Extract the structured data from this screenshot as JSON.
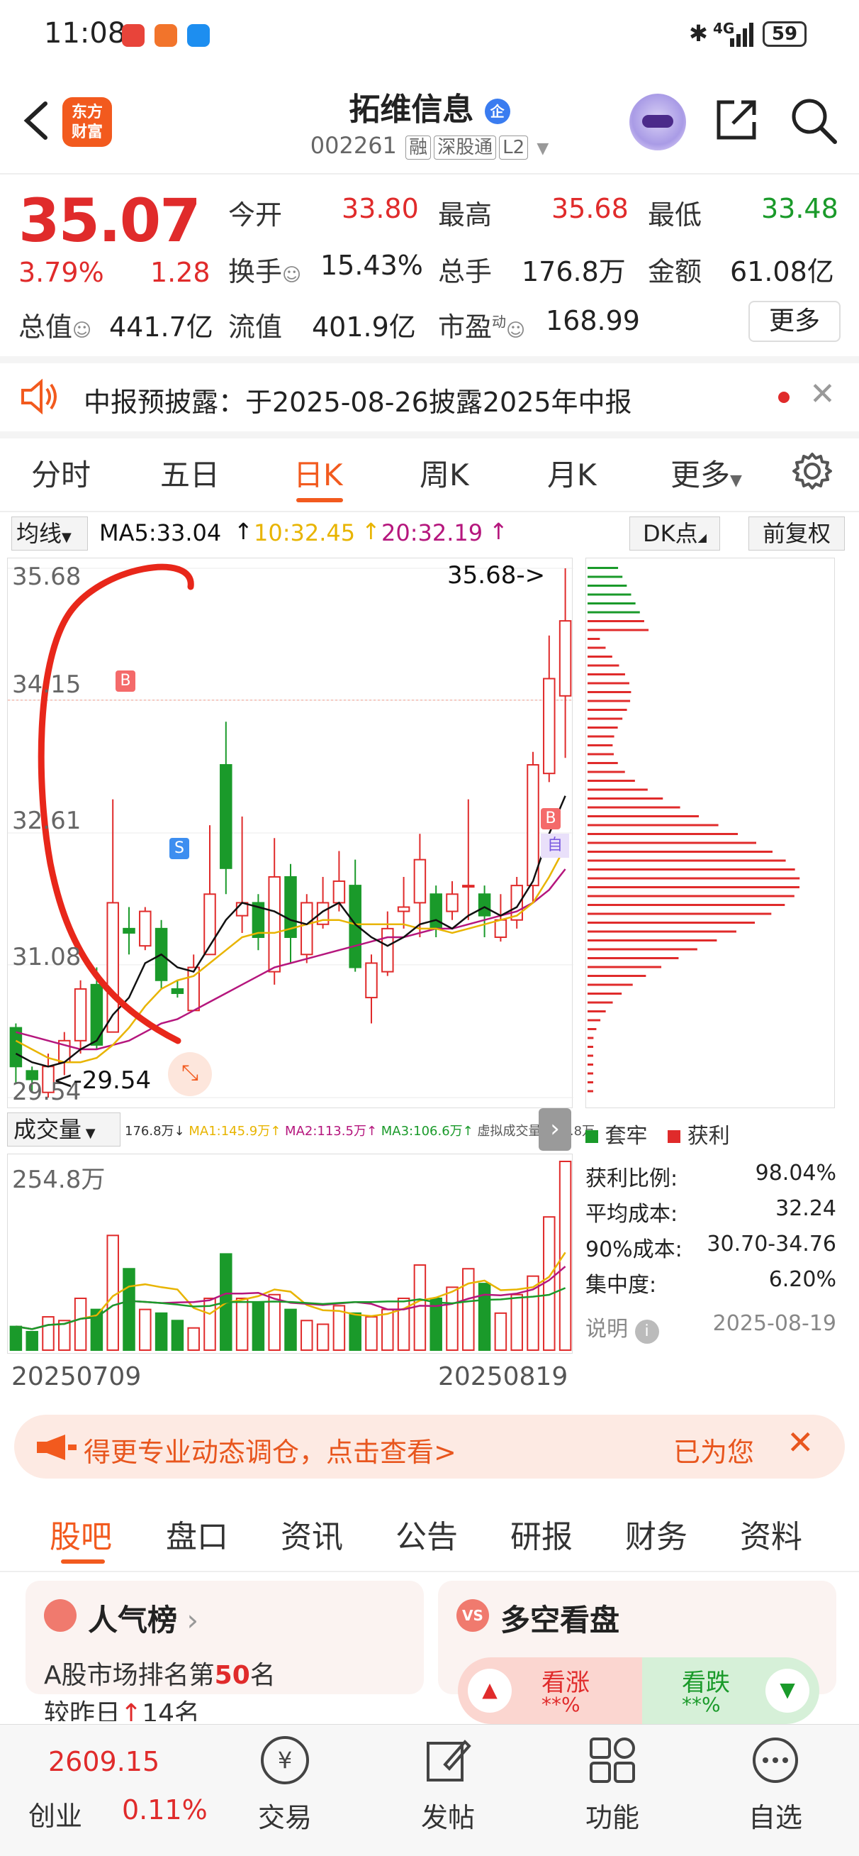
{
  "status_bar": {
    "time": "11:08",
    "network": "4G",
    "battery": "59"
  },
  "header": {
    "logo_line1": "东方",
    "logo_line2": "财富",
    "title": "拓维信息",
    "title_badge": "企",
    "code": "002261",
    "tags": [
      "融",
      "深股通",
      "L2"
    ]
  },
  "quote": {
    "price": "35.07",
    "change_pct": "3.79%",
    "change": "1.28",
    "open_label": "今开",
    "open": "33.80",
    "high_label": "最高",
    "high": "35.68",
    "low_label": "最低",
    "low": "33.48",
    "turnover_label": "换手",
    "turnover": "15.43%",
    "volume_label": "总手",
    "volume": "176.8万",
    "amount_label": "金额",
    "amount": "61.08亿",
    "mktcap_label": "总值",
    "mktcap": "441.7亿",
    "float_label": "流值",
    "float_cap": "401.9亿",
    "pe_label": "市盈",
    "pe_sup": "动",
    "pe": "168.99",
    "more_button": "更多"
  },
  "notice": {
    "text": "中报预披露：于2025-08-26披露2025年中报"
  },
  "kline_tabs": [
    "分时",
    "五日",
    "日K",
    "周K",
    "月K",
    "更多"
  ],
  "kline_active": "日K",
  "ma_bar": {
    "selector": "均线",
    "ma5": "MA5:33.04",
    "ma10": "10:32.45",
    "ma20": "20:32.19",
    "dk_button": "DK点",
    "fq_button": "前复权"
  },
  "chart_data": {
    "type": "candlestick",
    "y_ticks": [
      "35.68",
      "34.15",
      "32.61",
      "31.08",
      "29.54"
    ],
    "high_annotation": "35.68->",
    "low_annotation": "<-29.54",
    "start_date": "20250709",
    "end_date": "20250819",
    "volume_max_label": "254.8万",
    "candles": [
      {
        "o": 30.35,
        "c": 29.9,
        "h": 30.4,
        "l": 29.7
      },
      {
        "o": 29.85,
        "c": 29.75,
        "h": 29.9,
        "l": 29.6
      },
      {
        "o": 29.6,
        "c": 29.9,
        "h": 30.05,
        "l": 29.54
      },
      {
        "o": 29.95,
        "c": 30.2,
        "h": 30.3,
        "l": 29.8
      },
      {
        "o": 30.2,
        "c": 30.8,
        "h": 30.9,
        "l": 30.05
      },
      {
        "o": 30.85,
        "c": 30.15,
        "h": 31.05,
        "l": 30.1
      },
      {
        "o": 30.3,
        "c": 31.8,
        "h": 33.0,
        "l": 30.3
      },
      {
        "o": 31.5,
        "c": 31.45,
        "h": 31.75,
        "l": 31.2
      },
      {
        "o": 31.3,
        "c": 31.7,
        "h": 31.75,
        "l": 31.25
      },
      {
        "o": 31.5,
        "c": 30.9,
        "h": 31.6,
        "l": 30.8
      },
      {
        "o": 30.8,
        "c": 30.75,
        "h": 30.9,
        "l": 30.7
      },
      {
        "o": 30.55,
        "c": 31.05,
        "h": 31.2,
        "l": 30.55
      },
      {
        "o": 31.2,
        "c": 31.9,
        "h": 32.7,
        "l": 31.2
      },
      {
        "o": 33.4,
        "c": 32.2,
        "h": 33.9,
        "l": 31.9
      },
      {
        "o": 31.65,
        "c": 31.8,
        "h": 32.8,
        "l": 31.45
      },
      {
        "o": 31.8,
        "c": 31.4,
        "h": 31.9,
        "l": 31.25
      },
      {
        "o": 31.0,
        "c": 32.1,
        "h": 32.55,
        "l": 30.85
      },
      {
        "o": 32.1,
        "c": 31.4,
        "h": 32.25,
        "l": 31.1
      },
      {
        "o": 31.2,
        "c": 31.8,
        "h": 31.9,
        "l": 31.1
      },
      {
        "o": 31.55,
        "c": 31.8,
        "h": 32.1,
        "l": 31.5
      },
      {
        "o": 31.8,
        "c": 32.05,
        "h": 32.4,
        "l": 31.7
      },
      {
        "o": 32.0,
        "c": 31.05,
        "h": 32.3,
        "l": 31.0
      },
      {
        "o": 30.7,
        "c": 31.1,
        "h": 31.2,
        "l": 30.4
      },
      {
        "o": 31.0,
        "c": 31.5,
        "h": 31.7,
        "l": 30.95
      },
      {
        "o": 31.7,
        "c": 31.75,
        "h": 32.1,
        "l": 31.5
      },
      {
        "o": 31.8,
        "c": 32.3,
        "h": 32.6,
        "l": 31.4
      },
      {
        "o": 31.9,
        "c": 31.5,
        "h": 32.0,
        "l": 31.4
      },
      {
        "o": 31.7,
        "c": 31.9,
        "h": 32.05,
        "l": 31.6
      },
      {
        "o": 32.0,
        "c": 32.0,
        "h": 33.0,
        "l": 31.6
      },
      {
        "o": 31.9,
        "c": 31.65,
        "h": 32.0,
        "l": 31.4
      },
      {
        "o": 31.4,
        "c": 31.6,
        "h": 31.9,
        "l": 31.35
      },
      {
        "o": 31.6,
        "c": 32.0,
        "h": 32.1,
        "l": 31.5
      },
      {
        "o": 32.0,
        "c": 33.4,
        "h": 33.55,
        "l": 31.8
      },
      {
        "o": 33.3,
        "c": 34.4,
        "h": 34.9,
        "l": 33.2
      },
      {
        "o": 34.2,
        "c": 35.07,
        "h": 35.68,
        "l": 33.48
      }
    ],
    "ma5": [
      30.05,
      29.95,
      29.9,
      29.95,
      30.1,
      30.2,
      30.5,
      30.7,
      31.1,
      31.2,
      31.05,
      31.0,
      31.3,
      31.6,
      31.8,
      31.75,
      31.7,
      31.6,
      31.55,
      31.7,
      31.8,
      31.55,
      31.4,
      31.3,
      31.4,
      31.55,
      31.6,
      31.5,
      31.65,
      31.75,
      31.65,
      31.75,
      32.05,
      32.6,
      33.04
    ],
    "ma10": [
      30.2,
      30.1,
      30.0,
      29.95,
      29.95,
      30.0,
      30.15,
      30.35,
      30.6,
      30.8,
      30.9,
      30.95,
      31.1,
      31.25,
      31.4,
      31.45,
      31.45,
      31.5,
      31.55,
      31.6,
      31.6,
      31.55,
      31.55,
      31.55,
      31.55,
      31.5,
      31.5,
      31.45,
      31.5,
      31.55,
      31.6,
      31.65,
      31.8,
      32.1,
      32.45
    ],
    "ma20": [
      30.3,
      30.25,
      30.2,
      30.15,
      30.1,
      30.1,
      30.15,
      30.2,
      30.3,
      30.4,
      30.45,
      30.55,
      30.65,
      30.75,
      30.85,
      30.95,
      31.05,
      31.1,
      31.15,
      31.2,
      31.25,
      31.3,
      31.35,
      31.4,
      31.4,
      31.45,
      31.5,
      31.5,
      31.55,
      31.6,
      31.65,
      31.7,
      31.8,
      31.95,
      32.19
    ],
    "volumes": [
      0.32,
      0.25,
      0.45,
      0.4,
      0.7,
      0.55,
      1.55,
      1.1,
      0.55,
      0.5,
      0.4,
      0.3,
      0.7,
      1.3,
      0.7,
      0.65,
      0.75,
      0.55,
      0.4,
      0.35,
      0.6,
      0.5,
      0.45,
      0.55,
      0.7,
      1.15,
      0.7,
      0.85,
      1.1,
      0.9,
      0.5,
      0.75,
      1.0,
      1.8,
      2.55
    ],
    "volume_legend": {
      "label": "成交量",
      "vol": "176.8万",
      "ma1": "MA1:145.9万",
      "ma2": "MA2:113.5万",
      "ma3": "MA3:106.6万",
      "virtual": "虚拟成交量:254.8万"
    }
  },
  "chip_panel": {
    "legend_trap": "套牢",
    "legend_profit": "获利",
    "rows": [
      {
        "label": "获利比例:",
        "value": "98.04%"
      },
      {
        "label": "平均成本:",
        "value": "32.24"
      },
      {
        "label": "90%成本:",
        "value": "30.70-34.76"
      },
      {
        "label": "集中度:",
        "value": "6.20%"
      }
    ],
    "note_label": "说明",
    "note_date": "2025-08-19"
  },
  "banner": {
    "text": "得更专业动态调仓，点击查看>",
    "right_text": "已为您"
  },
  "sub_tabs": [
    "股吧",
    "盘口",
    "资讯",
    "公告",
    "研报",
    "财务",
    "资料"
  ],
  "sub_tab_active": "股吧",
  "popularity_card": {
    "title": "人气榜",
    "line1_prefix": "A股市场排名第",
    "rank": "50",
    "line1_suffix": "名",
    "line2_prefix": "较昨日",
    "change": "14",
    "line2_suffix": "名"
  },
  "sentiment_card": {
    "title": "多空看盘",
    "up_label": "看涨",
    "up_value": "**%",
    "down_label": "看跌",
    "down_value": "**%"
  },
  "bottom_nav": {
    "index_value": "2609.15",
    "index_name": "创业",
    "index_change": "0.11%",
    "items": [
      "交易",
      "发帖",
      "功能",
      "自选"
    ]
  },
  "colors": {
    "up": "#e02b2b",
    "down": "#1a9a2a",
    "brand": "#f25a1e",
    "ma5": "#111111",
    "ma10": "#e8b400",
    "ma20": "#b5167d"
  }
}
